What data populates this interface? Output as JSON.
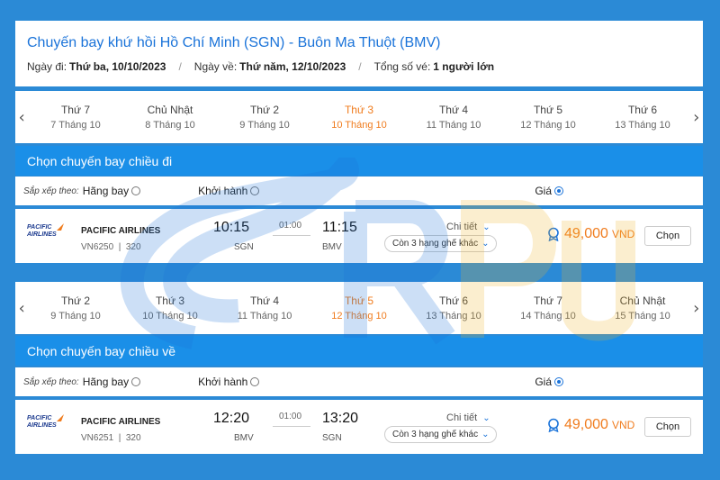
{
  "header": {
    "route_title": "Chuyến bay khứ hồi Hồ Chí Minh (SGN) - Buôn Ma Thuột (BMV)",
    "depart_label": "Ngày đi:",
    "depart_value": "Thứ ba, 10/10/2023",
    "return_label": "Ngày về:",
    "return_value": "Thứ năm, 12/10/2023",
    "tickets_label": "Tổng số vé:",
    "tickets_value": "1 người lớn",
    "sep": "/"
  },
  "nav": {
    "prev": "‹",
    "next": "›"
  },
  "outbound_dates": [
    {
      "day": "Thứ 7",
      "date": "7 Tháng 10"
    },
    {
      "day": "Chủ Nhật",
      "date": "8 Tháng 10"
    },
    {
      "day": "Thứ 2",
      "date": "9 Tháng 10"
    },
    {
      "day": "Thứ 3",
      "date": "10 Tháng 10"
    },
    {
      "day": "Thứ 4",
      "date": "11 Tháng 10"
    },
    {
      "day": "Thứ 5",
      "date": "12 Tháng 10"
    },
    {
      "day": "Thứ 6",
      "date": "13 Tháng 10"
    }
  ],
  "return_dates": [
    {
      "day": "Thứ 2",
      "date": "9 Tháng 10"
    },
    {
      "day": "Thứ 3",
      "date": "10 Tháng 10"
    },
    {
      "day": "Thứ 4",
      "date": "11 Tháng 10"
    },
    {
      "day": "Thứ 5",
      "date": "12 Tháng 10"
    },
    {
      "day": "Thứ 6",
      "date": "13 Tháng 10"
    },
    {
      "day": "Thứ 7",
      "date": "14 Tháng 10"
    },
    {
      "day": "Chủ Nhật",
      "date": "15 Tháng 10"
    }
  ],
  "outbound_section": "Chọn chuyến bay chiều đi",
  "return_section": "Chọn chuyến bay chiều về",
  "sort": {
    "label": "Sắp xếp theo:",
    "airline": "Hãng bay",
    "departure": "Khởi hành",
    "price": "Giá"
  },
  "outbound_flight": {
    "logo": "PACIFIC AIRLINES",
    "airline": "PACIFIC AIRLINES",
    "flight_no": "VN6250",
    "fare_class": "320",
    "depart_time": "10:15",
    "depart_code": "SGN",
    "duration": "01:00",
    "arrive_time": "11:15",
    "arrive_code": "BMV",
    "detail": "Chi tiết",
    "classes": "Còn 3 hạng ghế khác",
    "price": "49,000",
    "currency": "VND",
    "choose": "Chọn"
  },
  "return_flight": {
    "logo": "PACIFIC AIRLINES",
    "airline": "PACIFIC AIRLINES",
    "flight_no": "VN6251",
    "fare_class": "320",
    "depart_time": "12:20",
    "depart_code": "BMV",
    "duration": "01:00",
    "arrive_time": "13:20",
    "arrive_code": "SGN",
    "detail": "Chi tiết",
    "classes": "Còn 3 hạng ghế khác",
    "price": "49,000",
    "currency": "VND",
    "choose": "Chọn"
  },
  "colors": {
    "background": "#2b8ad6",
    "accent": "#1a73d9",
    "section_bar": "#1a8fe8",
    "active_date": "#f07c1e",
    "price": "#f07c1e"
  }
}
